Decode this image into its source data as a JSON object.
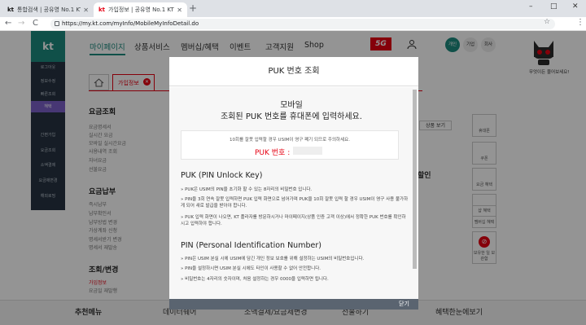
{
  "browser": {
    "tabs": [
      {
        "favicon": "kt",
        "title": "통합검색 | 공유영 No.1 KT"
      },
      {
        "favicon": "kt",
        "title": "가입정보 | 공유영 No.1 KT"
      }
    ],
    "new_tab": "+",
    "window_controls": [
      "–",
      "□",
      "✕"
    ],
    "nav": {
      "back": "←",
      "forward": "→",
      "reload": "C"
    },
    "url": "https://my.kt.com/myInfo/MobileMyInfoDetail.do"
  },
  "site": {
    "logo": "kt",
    "left_nav": [
      "로그아웃",
      "정보수정",
      "빠른조회",
      "헤택",
      "간편가입",
      "요금조회",
      "소액결제",
      "요금제변경",
      "해외로밍"
    ],
    "gnb": [
      "마이페이지",
      "상품서비스",
      "멤버십/혜택",
      "이벤트",
      "고객지원",
      "Shop"
    ],
    "fiveg": "5G",
    "circles": [
      "개인",
      "기업",
      "회사"
    ],
    "mascot_text": "무엇이든 물어보세요!",
    "tab_label": "가입정보",
    "sections": [
      {
        "title": "요금조회",
        "items": [
          "요금명세서",
          "실시간 요금",
          "모바일 실시간요금",
          "사용내역 조회",
          "자녀요금",
          "선불요금"
        ]
      },
      {
        "title": "요금납부",
        "items": [
          "즉시납부",
          "납부확인서",
          "납부방법 변경",
          "가상계좌 신청",
          "명세서받기 변경",
          "명세서 재발송"
        ]
      },
      {
        "title": "조회/변경",
        "items": [
          "가입정보",
          "요금일 재발행"
        ]
      }
    ],
    "right_sidebar": [
      "휴대폰",
      "쿠폰",
      "요금 혜택",
      "샵 혜택",
      "멤버십 혜택"
    ],
    "right_sidebar_cta": "보유한 일 보관함",
    "behind_modal": {
      "button": "상품 보기",
      "text": "할인"
    },
    "footer_label": "추천메뉴",
    "footer_items": [
      "데이터쉐어",
      "소액결제/요금제변경",
      "선물하기",
      "혜택한눈에보기"
    ]
  },
  "modal": {
    "title": "PUK 번호 조회",
    "intro_line1": "모바일",
    "intro_line2": "조회된 PUK 번호를 휴대폰에 입력하세요.",
    "warning": "10회를 잘못 입력할 경우 USIM이 영구 폐기 되므로 주의하세요.",
    "puk_label": "PUK 번호 :",
    "puk_heading": "PUK (PIN Unlock Key)",
    "puk_points": [
      "» PUK은 USIM의 PIN을 초기화 할 수 있는 8자리의 비밀번호 입니다.",
      "» PIN을 3회 연속 잘못 입력하면 PUK 입력 화면으로 넘어가며 PUK을 10회 잘못 입력 할 경우 USIM이 영구 사용 불가하게 되어 새로 발급을 받아야 합니다.",
      "» PUK 입력 화면이 나오면, KT 플라자를 방문하시거나 마이페이지(상품 인증 고객 이상)에서 정확한 PUK 번호를 확인하시고 입력하야 합니다."
    ],
    "pin_heading": "PIN (Personal Identification Number)",
    "pin_points": [
      "» PIN은 USIM 분실 시에 USIM에 담긴 개인 정보 보호를 위해 설정하는 USIM의 비밀번호입니다.",
      "» PIN을 설정하시면 USIM 분실 시에도 타인이 사용할 수 없어 안전합니다.",
      "» 비밀번호는 4자리의 숫자이며, 처음 설정하는 경우 0000을 입력하면 됩니다."
    ],
    "close": "닫기"
  }
}
